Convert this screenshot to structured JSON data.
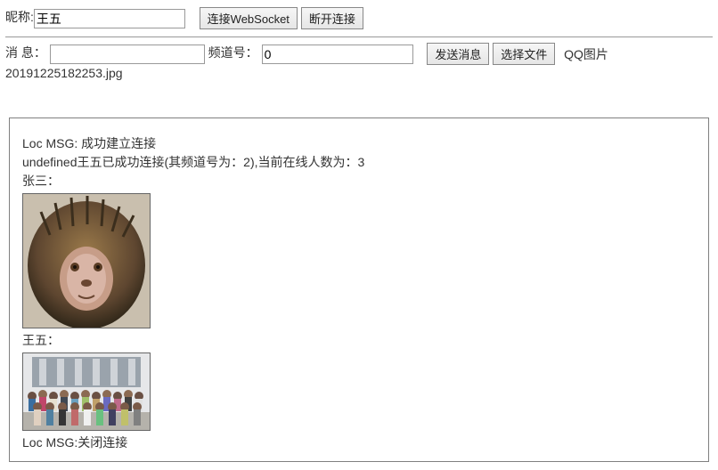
{
  "row1": {
    "nickname_label": "昵称:",
    "nickname_value": "王五",
    "connect_label": "连接WebSocket",
    "disconnect_label": "断开连接"
  },
  "row2": {
    "message_label": "消 息：",
    "message_value": "",
    "channel_label": "频道号：",
    "channel_value": "0",
    "send_label": "发送消息",
    "choose_file_label": "选择文件",
    "file_name": "QQ图片20191225182253.jpg"
  },
  "messages": {
    "line1": "Loc MSG: 成功建立连接",
    "line2": "undefined王五已成功连接(其频道号为：2),当前在线人数为：3",
    "user1": "张三：",
    "user2": "王五：",
    "line_close": "Loc MSG:关闭连接"
  }
}
